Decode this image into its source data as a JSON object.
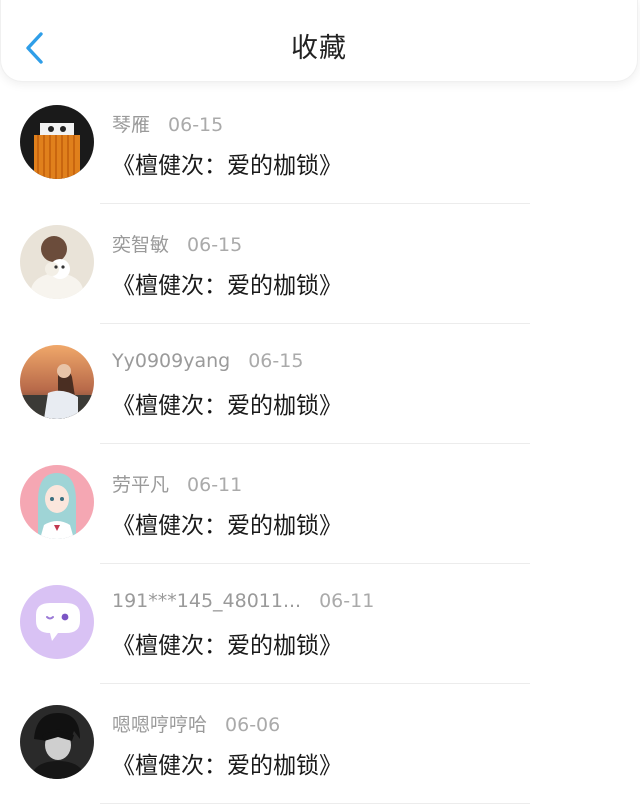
{
  "header": {
    "title": "收藏",
    "back_icon": "chevron-left-icon",
    "accent_color": "#2f9ee8"
  },
  "items": [
    {
      "username": "琴雁",
      "date": "06-15",
      "content": "《檀健次：爱的枷锁》",
      "avatar_icon": "user-avatar-icon"
    },
    {
      "username": "奕智敏",
      "date": "06-15",
      "content": "《檀健次：爱的枷锁》",
      "avatar_icon": "user-avatar-icon"
    },
    {
      "username": "Yy0909yang",
      "date": "06-15",
      "content": "《檀健次：爱的枷锁》",
      "avatar_icon": "user-avatar-icon"
    },
    {
      "username": "劳平凡",
      "date": "06-11",
      "content": "《檀健次：爱的枷锁》",
      "avatar_icon": "user-avatar-icon"
    },
    {
      "username": "191***145_48011...",
      "date": "06-11",
      "content": "《檀健次：爱的枷锁》",
      "avatar_icon": "chat-bubble-avatar-icon"
    },
    {
      "username": "嗯嗯哼哼哈",
      "date": "06-06",
      "content": "《檀健次：爱的枷锁》",
      "avatar_icon": "user-avatar-icon"
    }
  ]
}
